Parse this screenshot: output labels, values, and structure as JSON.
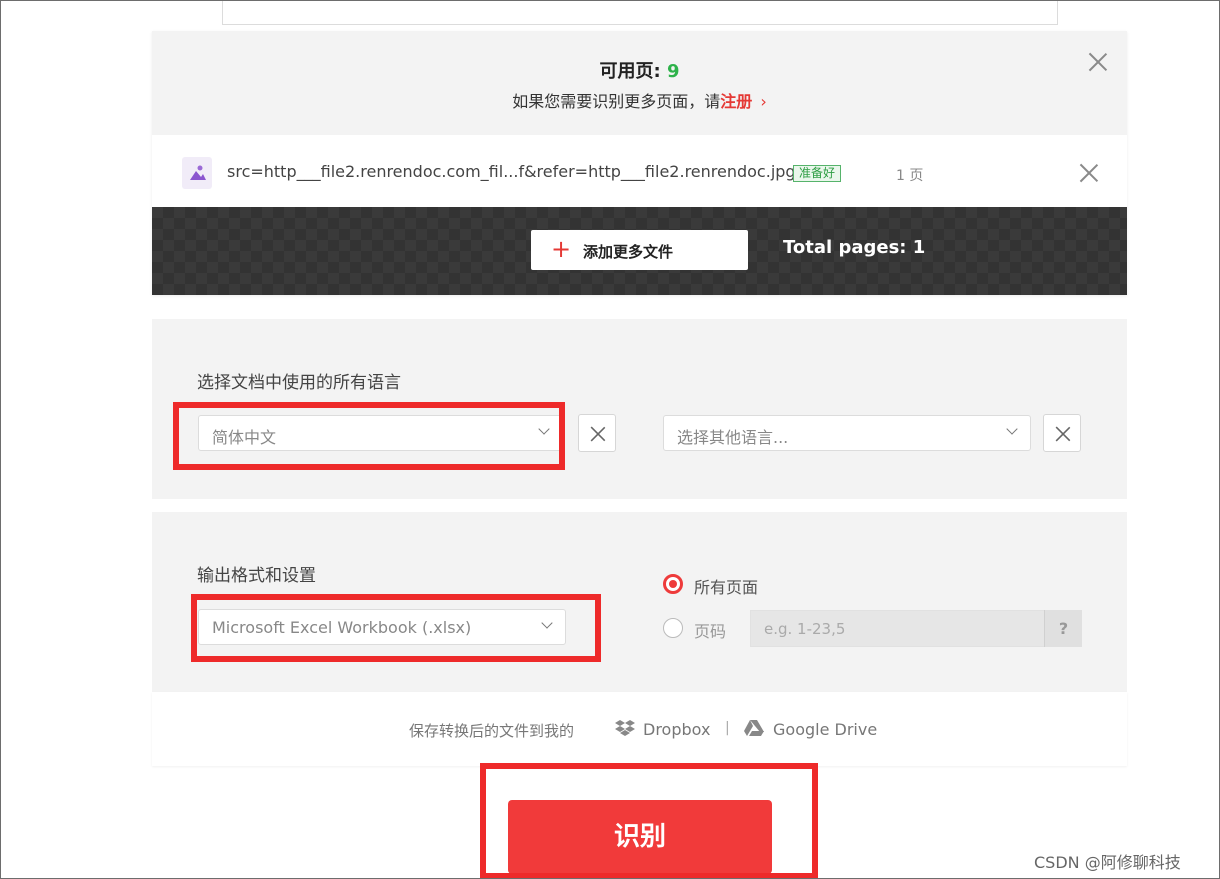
{
  "limit": {
    "label": "可用页: ",
    "count": "9"
  },
  "hint": {
    "text": "如果您需要识别更多页面，请",
    "link": "注册",
    "chevron": "›"
  },
  "file": {
    "name": "src=http___file2.renrendoc.com_fil...f&refer=http___file2.renrendoc.jpg",
    "status": "准备好",
    "pages": "1 页"
  },
  "toolbar": {
    "add_icon": "+",
    "add_label": "添加更多文件",
    "total": "Total pages: 1"
  },
  "language": {
    "title": "选择文档中使用的所有语言",
    "selected": "简体中文",
    "other_placeholder": "选择其他语言..."
  },
  "output": {
    "title": "输出格式和设置",
    "format": "Microsoft Excel Workbook (.xlsx)",
    "all_pages": "所有页面",
    "page_range": "页码",
    "range_placeholder": "e.g. 1-23,5",
    "help": "?"
  },
  "save": {
    "label": "保存转换后的文件到我的",
    "dropbox": "Dropbox",
    "separator": "|",
    "gdrive": "Google Drive"
  },
  "convert_label": "识别",
  "watermark": "CSDN @阿修聊科技",
  "colors": {
    "accent": "#ee2a2a",
    "success": "#2db24a",
    "dark": "#3a3a3a"
  }
}
